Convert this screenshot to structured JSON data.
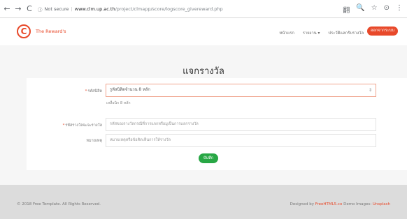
{
  "browser": {
    "back_icon": "←",
    "forward_icon": "→",
    "reload_icon": "C",
    "info_icon": "ⓘ",
    "security_text": "Not secure",
    "url_host": "www.clm.up.ac.th",
    "url_path": "/project/clmapp/score/logscore_givereward.php",
    "right_icons": [
      "翻",
      "🔍",
      "☆",
      "⊙",
      "⋮"
    ]
  },
  "header": {
    "logo_letter": "C",
    "logo_text": "The Reward's",
    "menu": [
      "หน้าแรก",
      "รายงาน ▾",
      "ประวัติแลกรับรางวัล"
    ],
    "logout_label": "ออกจากระบบ"
  },
  "main": {
    "title": "แจกรางวัล",
    "student_label": "รหัสนิสิต",
    "student_select_value": "รูหัสนิสิตจำนวน 8 หลัก",
    "select_arrow": "⇕",
    "hint": "เหลือนิก 8 หลัก",
    "reward_label": "รหัสรางวัลจะจะรางวัล",
    "reward_placeholder": "รหัสของรางวัลกรณีที่การแจกหรือมูเป็นการแลกรางวัล",
    "note_label": "หมายเหตุ",
    "note_placeholder": "หมายเหตุหรือข้อคิดเห็นการให้รางวัล",
    "save_label": "บันทึก"
  },
  "footer": {
    "copyright": "© 2018 Free Template. All Rights Reserved.",
    "designed_prefix": "Designed by",
    "designed_link": "FreeHTML5.co",
    "demo_prefix": "Demo Images:",
    "demo_link": "Unsplash"
  },
  "colors": {
    "accent": "#e8492a",
    "save": "#28a745"
  }
}
